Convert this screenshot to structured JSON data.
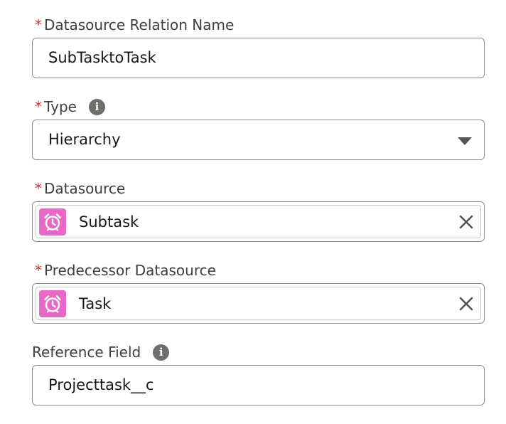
{
  "fields": {
    "relation_name": {
      "required_mark": "*",
      "label": "Datasource Relation Name",
      "value": "SubTasktoTask"
    },
    "type": {
      "required_mark": "*",
      "label": "Type",
      "info_icon": "info-icon",
      "value": "Hierarchy",
      "dropdown_icon": "chevron-down-icon"
    },
    "datasource": {
      "required_mark": "*",
      "label": "Datasource",
      "value": "Subtask",
      "icon": "alarm-clock-icon",
      "clear_icon": "close-icon"
    },
    "predecessor": {
      "required_mark": "*",
      "label": "Predecessor Datasource",
      "value": "Task",
      "icon": "alarm-clock-icon",
      "clear_icon": "close-icon"
    },
    "reference_field": {
      "label": "Reference Field",
      "info_icon": "info-icon",
      "value": "Projecttask__c"
    }
  },
  "colors": {
    "required": "#c23934",
    "label": "#3e3e3c",
    "border": "#8e8e8e",
    "object_icon_bg": "#e768c6",
    "info_icon_bg": "#706e6b"
  }
}
